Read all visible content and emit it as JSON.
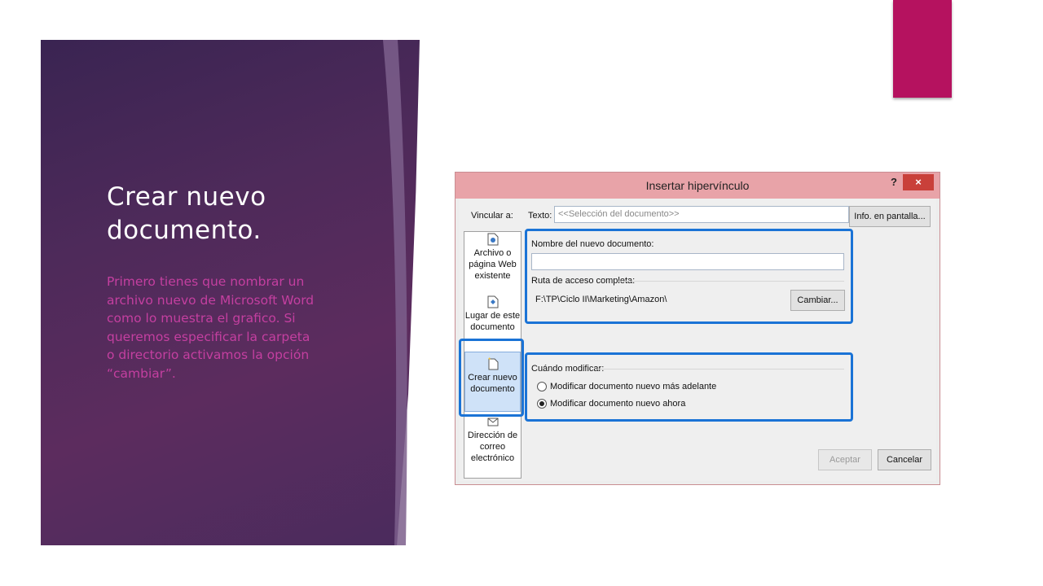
{
  "slide": {
    "title": "Crear nuevo documento.",
    "body": "Primero tienes que nombrar un archivo nuevo de Microsoft Word como lo muestra el grafico. Si queremos especificar la carpeta o directorio activamos la opción “cambiar”."
  },
  "colors": {
    "panel": "#4e2a5a",
    "accent_pink": "#b5125f",
    "body_text": "#c43fa0",
    "highlight": "#1a73d6"
  },
  "dialog": {
    "title": "Insertar hipervínculo",
    "help_label": "?",
    "close_label": "×",
    "link_to_label": "Vincular a:",
    "text_label": "Texto:",
    "text_value": "<<Selección del documento>>",
    "info_button_label": "Info. en pantalla...",
    "nav_items": [
      {
        "label": "Archivo o página Web existente",
        "icon": "file-web-icon"
      },
      {
        "label": "Lugar de este documento",
        "icon": "document-place-icon"
      },
      {
        "label": "Crear nuevo documento",
        "icon": "new-document-icon"
      },
      {
        "label": "Dirección de correo electrónico",
        "icon": "email-icon"
      }
    ],
    "new_doc_name_label": "Nombre del nuevo documento:",
    "new_doc_name_value": "",
    "full_path_label": "Ruta de acceso completa:",
    "full_path_value": "F:\\TP\\Ciclo II\\Marketing\\Amazon\\",
    "change_button_label": "Cambiar...",
    "when_label": "Cuándo modificar:",
    "radio_later_label": "Modificar documento nuevo más adelante",
    "radio_now_label": "Modificar documento nuevo ahora",
    "radio_selected": "now",
    "ok_label": "Aceptar",
    "cancel_label": "Cancelar"
  }
}
